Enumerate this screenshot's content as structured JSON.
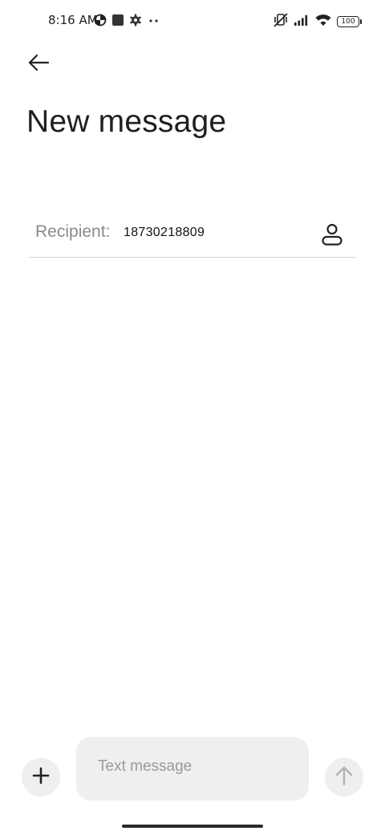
{
  "status_bar": {
    "time": "8:16 AM",
    "battery_level": "100",
    "left_icons": [
      "data-saver-icon",
      "notification-square-icon",
      "settings-gear-icon",
      "more-dots-icon"
    ],
    "right_icons": [
      "vibrate-off-icon",
      "signal-icon",
      "wifi-icon",
      "battery-icon"
    ]
  },
  "header": {
    "back_icon": "arrow-left-icon",
    "title": "New message"
  },
  "recipient": {
    "label": "Recipient:",
    "value": "18730218809",
    "contact_icon": "person-icon"
  },
  "compose": {
    "add_icon": "plus-icon",
    "placeholder": "Text message",
    "value": "",
    "send_icon": "arrow-up-icon"
  }
}
